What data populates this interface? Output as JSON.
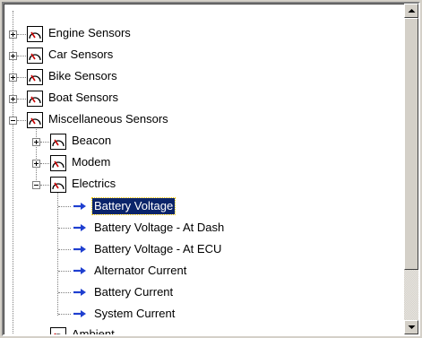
{
  "tree": {
    "items": [
      {
        "label": "Engine Sensors",
        "expander": "+"
      },
      {
        "label": "Car Sensors",
        "expander": "+"
      },
      {
        "label": "Bike Sensors",
        "expander": "+"
      },
      {
        "label": "Boat Sensors",
        "expander": "+"
      },
      {
        "label": "Miscellaneous Sensors",
        "expander": "-",
        "children": [
          {
            "label": "Beacon",
            "expander": "+"
          },
          {
            "label": "Modem",
            "expander": "+"
          },
          {
            "label": "Electrics",
            "expander": "-",
            "children": [
              {
                "label": "Battery Voltage",
                "selected": true
              },
              {
                "label": "Battery Voltage - At Dash"
              },
              {
                "label": "Battery Voltage - At ECU"
              },
              {
                "label": "Alternator Current"
              },
              {
                "label": "Battery Current"
              },
              {
                "label": "System Current"
              }
            ]
          }
        ]
      }
    ],
    "partial_item_label": "Ambient"
  },
  "colors": {
    "selection": "#0a246a",
    "arrow": "#1f3fd0",
    "gauge_needle": "#cc0000"
  },
  "icons": {
    "gauge": "gauge-icon",
    "arrow": "arrow-right-icon"
  }
}
